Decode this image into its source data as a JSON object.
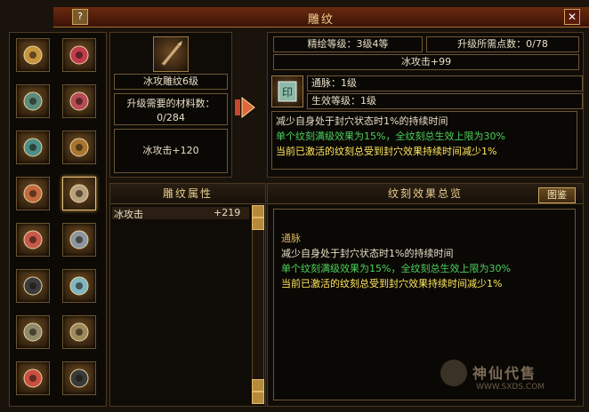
{
  "window": {
    "title": "雕纹",
    "help_label": "?",
    "close_label": "✕"
  },
  "left_slots": [
    {
      "icon": "staff-icon"
    },
    {
      "icon": "red-gem-icon"
    },
    {
      "icon": "armor-icon"
    },
    {
      "icon": "red-ring-icon"
    },
    {
      "icon": "bracer-icon"
    },
    {
      "icon": "belt-icon"
    },
    {
      "icon": "shoulder-icon"
    },
    {
      "icon": "dagger-icon"
    },
    {
      "icon": "chest-icon"
    },
    {
      "icon": "gauntlet-icon"
    },
    {
      "icon": "blade-icon"
    },
    {
      "icon": "wing-icon"
    },
    {
      "icon": "jade-disc-icon"
    },
    {
      "icon": "jade-disc-icon"
    },
    {
      "icon": "necklace-icon"
    },
    {
      "icon": "dark-emblem-icon"
    }
  ],
  "selected_item": {
    "name": "冰攻雕纹6级",
    "material_label": "升级需要的材料数：",
    "material_value": "0/284",
    "attr_text": "冰攻击+120"
  },
  "right_info": {
    "refine_level": "精绘等级：3级4等",
    "upgrade_points": "升级所需点数：0/78",
    "attr_bonus": "冰攻击+99",
    "effect_name": "通脉：1级",
    "effect_level": "生效等级：1级",
    "desc_line1": "减少自身处于封穴状态时1%的持续时间",
    "desc_line2": "单个纹刻满级效果为15%，全纹刻总生效上限为30%",
    "desc_line3": "当前已激活的纹刻总受到封穴效果持续时间减少1%"
  },
  "attr_panel": {
    "header": "雕纹属性",
    "rows": [
      {
        "name": "冰攻击",
        "value": "+219"
      }
    ]
  },
  "summary_panel": {
    "header": "纹刻效果总览",
    "button": "图鉴",
    "title": "通脉",
    "line1": "减少自身处于封穴状态时1%的持续时间",
    "line2": "单个纹刻满级效果为15%，全纹刻总生效上限为30%",
    "line3": "当前已激活的纹刻总受到封穴效果持续时间减少1%"
  },
  "watermark": {
    "text": "神仙代售",
    "url": "WWW.SXDS.COM"
  }
}
